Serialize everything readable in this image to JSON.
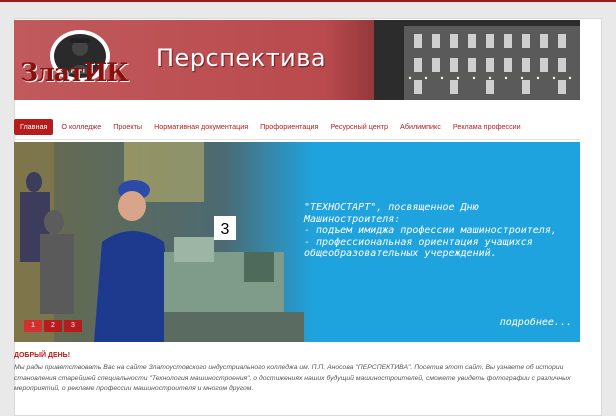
{
  "header": {
    "logo_text": "ЗлатИК",
    "title": "Перспектива"
  },
  "nav": {
    "items": [
      {
        "label": "Главная",
        "active": true
      },
      {
        "label": "О колледже"
      },
      {
        "label": "Проекты"
      },
      {
        "label": "Нормативная документация"
      },
      {
        "label": "Профориентация"
      },
      {
        "label": "Ресурсный центр"
      },
      {
        "label": "Абилимпикс"
      },
      {
        "label": "Реклама профессии"
      }
    ]
  },
  "slider": {
    "text": "\"ТЕХНОСТАРТ\", посвященное Дню Машиностроителя:\n- подъем имиджа профессии машиностроителя,\n- профессиональная ориентация учащихся общеобразовательных учереждений.",
    "more_label": "подробнее...",
    "dots": [
      "1",
      "2",
      "3"
    ],
    "badge": "3"
  },
  "content": {
    "greeting": "ДОБРЫЙ ДЕНЬ!",
    "intro": "Мы рады приветствовать Вас на сайте Златоустовского индустриального колледжа им. П.П. Аносова \"ПЕРСПЕКТИВА\". Посетив этот сайт, Вы узнаете об истории становления старейшей специальности \"Технология машиностроения\", о достижениях наших будущий машиностроителей, сможете увидеть фотографии с различных мероприятий, о рекламе профессии машиностроителя и многом другом."
  },
  "colors": {
    "accent": "#b71c1c",
    "slider_bg": "#1fa3de"
  }
}
